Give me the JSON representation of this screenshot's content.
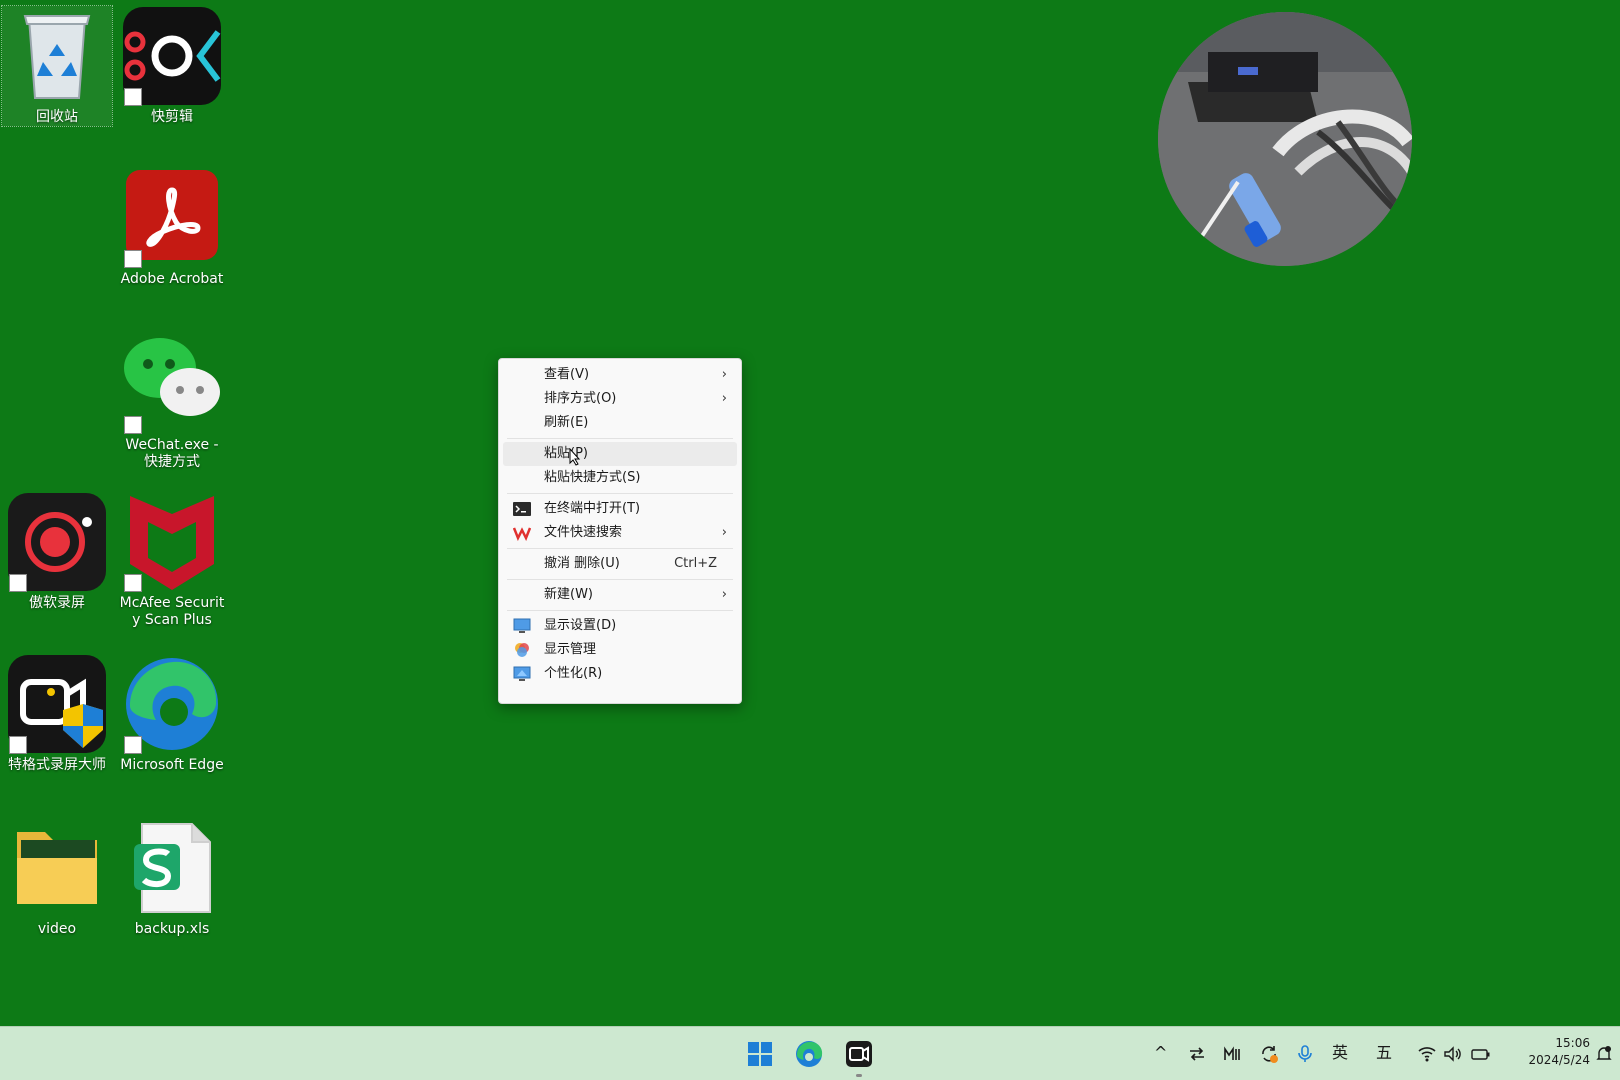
{
  "desktop": {
    "icons": [
      {
        "label": "回收站"
      },
      {
        "label": "快剪辑"
      },
      {
        "label": "Adobe Acrobat"
      },
      {
        "label": "WeChat.exe - 快捷方式"
      },
      {
        "label": "傲软录屏"
      },
      {
        "label": "McAfee Security Scan Plus"
      },
      {
        "label": "特格式录屏大师"
      },
      {
        "label": "Microsoft Edge"
      },
      {
        "label": "video"
      },
      {
        "label": "backup.xls"
      }
    ]
  },
  "context_menu": {
    "items": [
      {
        "label": "查看(V)",
        "arrow": "›"
      },
      {
        "label": "排序方式(O)",
        "arrow": "›"
      },
      {
        "label": "刷新(E)"
      },
      {
        "label": "粘贴(P)"
      },
      {
        "label": "粘贴快捷方式(S)"
      },
      {
        "label": "在终端中打开(T)"
      },
      {
        "label": "文件快速搜索",
        "arrow": "›"
      },
      {
        "label": "撤消 删除(U)",
        "shortcut": "Ctrl+Z"
      },
      {
        "label": "新建(W)",
        "arrow": "›"
      },
      {
        "label": "显示设置(D)"
      },
      {
        "label": "显示管理"
      },
      {
        "label": "个性化(R)"
      }
    ]
  },
  "taskbar": {
    "tray": {
      "chevron": "^",
      "ime_lang": "英",
      "ime_mode": "五"
    },
    "clock": {
      "time": "15:06",
      "date": "2024/5/24"
    }
  },
  "colors": {
    "desktop_bg": "#0d7a16",
    "taskbar_bg": "#cde8d0",
    "menu_bg": "#f9f9f9"
  }
}
